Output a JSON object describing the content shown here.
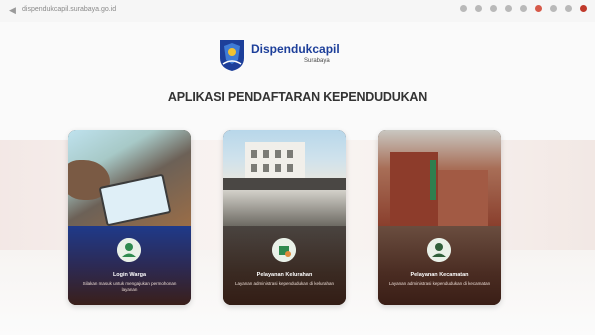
{
  "browser": {
    "url": "dispendukcapil.surabaya.go.id"
  },
  "logo": {
    "name": "Dispendukcapil",
    "sub": "Surabaya"
  },
  "heading": "APLIKASI PENDAFTARAN KEPENDUDUKAN",
  "cards": [
    {
      "title": "Login Warga",
      "desc": "Silakan masuk untuk mengajukan permohonan layanan",
      "icon": "user-icon"
    },
    {
      "title": "Pelayanan Kelurahan",
      "desc": "Layanan administrasi kependudukan di kelurahan",
      "icon": "office-icon"
    },
    {
      "title": "Pelayanan Kecamatan",
      "desc": "Layanan administrasi kependudukan di kecamatan",
      "icon": "admin-icon"
    }
  ],
  "colors": {
    "brand": "#1d3f9a",
    "heading": "#333333",
    "card": "#3a1e16"
  }
}
